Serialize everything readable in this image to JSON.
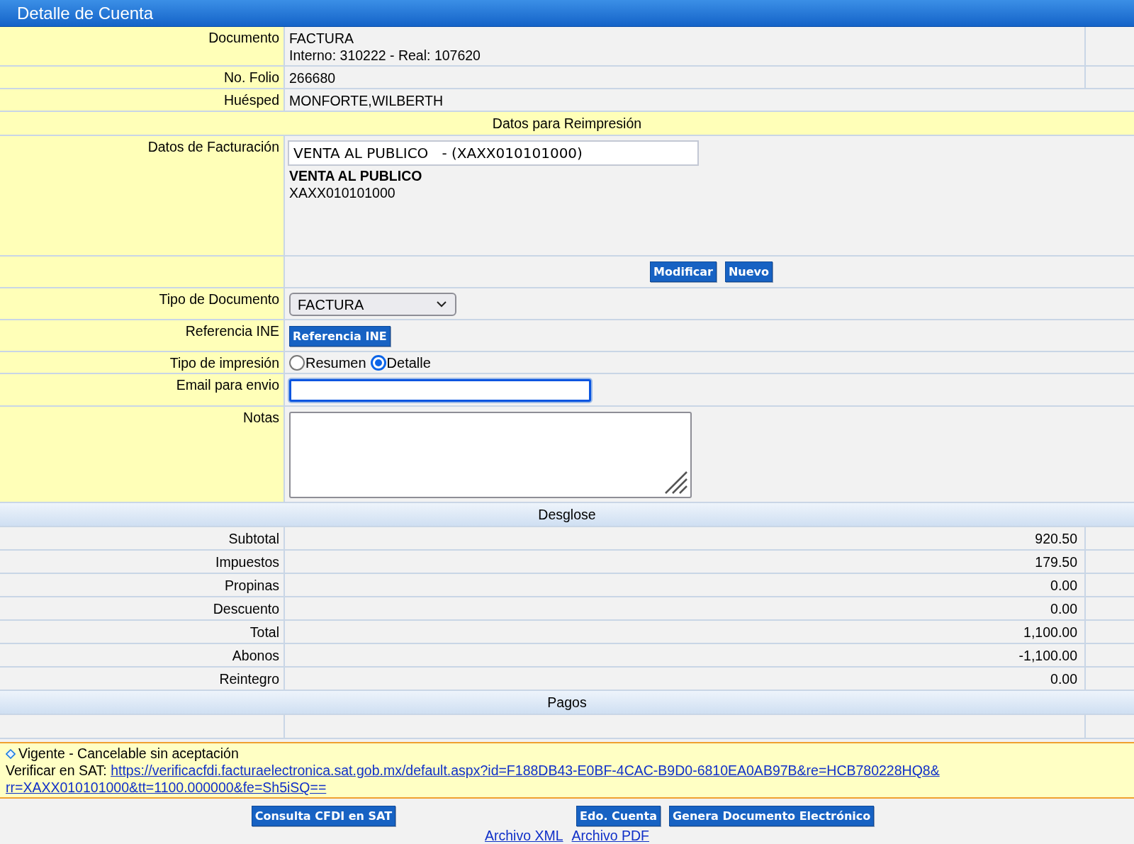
{
  "window": {
    "title": "Detalle de Cuenta"
  },
  "info_rows": [
    {
      "label": "Documento",
      "lines": [
        "FACTURA",
        "Interno: 310222 - Real: 107620"
      ]
    },
    {
      "label": "No. Folio",
      "lines": [
        "266680"
      ]
    },
    {
      "label": "Huésped",
      "lines": [
        "MONFORTE,WILBERTH"
      ]
    }
  ],
  "reprint": {
    "heading": "Datos para Reimpresión",
    "billing": {
      "label": "Datos de Facturación",
      "field_value": "VENTA AL PUBLICO   - (XAXX010101000)",
      "name": "VENTA AL PUBLICO",
      "rfc": "XAXX010101000"
    },
    "buttons": [
      "Modificar",
      "Nuevo"
    ],
    "document_type": {
      "label": "Tipo de Documento",
      "value": "FACTURA"
    },
    "ine": {
      "label": "Referencia INE",
      "button": "Referencia INE"
    },
    "print_type": {
      "label": "Tipo de impresión",
      "options": [
        {
          "label": "Resumen",
          "selected": false
        },
        {
          "label": "Detalle",
          "selected": true
        }
      ]
    },
    "email": {
      "label": "Email para envio"
    },
    "notes": {
      "label": "Notas"
    }
  },
  "breakdown": {
    "heading": "Desglose",
    "rows": [
      {
        "label": "Subtotal",
        "amount": "920.50"
      },
      {
        "label": "Impuestos",
        "amount": "179.50"
      },
      {
        "label": "Propinas",
        "amount": "0.00"
      },
      {
        "label": "Descuento",
        "amount": "0.00"
      },
      {
        "label": "Total",
        "amount": "1,100.00"
      },
      {
        "label": "Abonos",
        "amount": "-1,100.00"
      },
      {
        "label": "Reintegro",
        "amount": "0.00"
      }
    ]
  },
  "payments": {
    "heading": "Pagos"
  },
  "status": {
    "text": "Vigente - Cancelable sin aceptación",
    "verify_label": "Verificar en SAT:",
    "link_lines": [
      "https://verificacfdi.facturaelectronica.sat.gob.mx/default.aspx?id=F188DB43-E0BF-4CAC-B9D0-6810EA0AB97B&re=HCB780228HQ8&",
      "rr=XAXX010101000&tt=1100.000000&fe=Sh5iSQ=="
    ]
  },
  "footer": {
    "buttons": [
      "Consulta CFDI en SAT",
      "Edo. Cuenta",
      "Genera Documento Electrónico"
    ],
    "links": [
      "Archivo XML",
      "Archivo PDF"
    ]
  }
}
